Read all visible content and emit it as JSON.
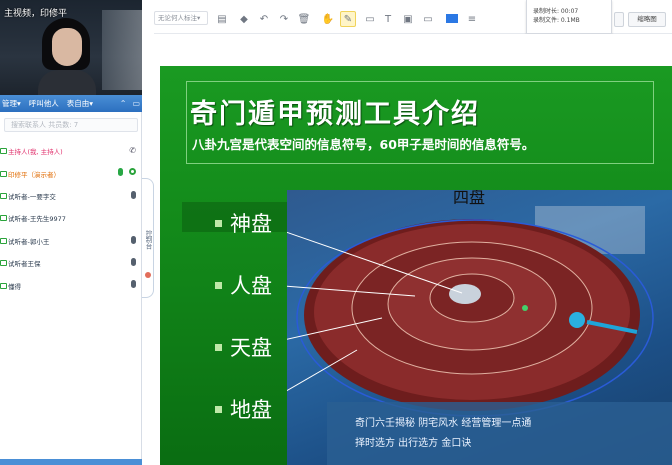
{
  "video": {
    "title": "主视频，印修平"
  },
  "tabs": {
    "items": [
      "管理▾",
      "呼叫他人",
      "表自由▾"
    ]
  },
  "search": {
    "placeholder": "搜索联系人 共员数: 7"
  },
  "members": [
    {
      "name": "主持人(我, 主持人)",
      "style": "host"
    },
    {
      "name": "印修平（演示者）",
      "style": "orange"
    },
    {
      "name": "试听者-一要字交",
      "style": "normal"
    },
    {
      "name": "试听者-王先生9977",
      "style": "normal"
    },
    {
      "name": "试听者-郭小王",
      "style": "normal"
    },
    {
      "name": "试听者王保",
      "style": "normal"
    },
    {
      "name": "懂得",
      "style": "normal"
    }
  ],
  "side_handle": {
    "label": "控制台"
  },
  "toolbar": {
    "pen_select": "无论何人标注▾",
    "record": {
      "line1": "录制时长: 00:07",
      "line2": "录制文件: 0.1MB"
    },
    "thumbnail_label": "缩略图"
  },
  "slide": {
    "title": "奇门遁甲预测工具介绍",
    "subtitle": "八卦九宫是代表空间的信息符号，60甲子是时间的信息符号。",
    "photo_caption": "四盘",
    "bullets": [
      "神盘",
      "人盘",
      "天盘",
      "地盘"
    ],
    "photo_text": {
      "bottom1": "奇门六壬揭秘  阴宅风水  经营管理一点通",
      "bottom2": "择时选方  出行选方  金口诀"
    }
  },
  "colors": {
    "accent": "#2c6fbf",
    "slide_green": "#138a1a",
    "plate": "#7a2323"
  }
}
